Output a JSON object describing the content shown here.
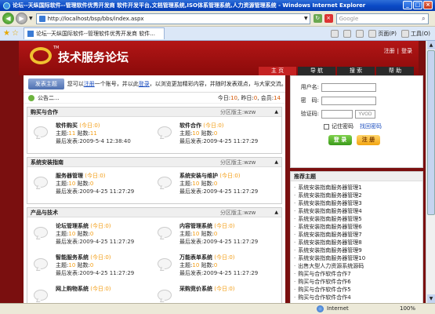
{
  "window": {
    "title": "论坛--天纵国际软件--管理软件优秀开发商 软件开发平台,文档管理系统,ISO体系管理系统,人力资源管理系统 - Windows Internet Explorer",
    "min": "_",
    "max": "□",
    "close": "×"
  },
  "address": {
    "url": "http://localhost/bsp/bbs/index.aspx"
  },
  "search": {
    "placeholder": "Google"
  },
  "tab": {
    "label": "论坛--天纵国际软件--管理软件优秀开发商 软件..."
  },
  "tools": {
    "page": "页面(P)",
    "tools": "工具(O)"
  },
  "header": {
    "logo_tm": "TM",
    "logo_text": "技术服务论坛",
    "register": "注册",
    "login": "登录",
    "nav": [
      "主 页",
      "导 航",
      "搜 索",
      "帮 助"
    ]
  },
  "topbar": {
    "post_button": "发表主题",
    "intro_prefix": "您可以",
    "intro_register": "注册",
    "intro_middle": "一个账号，并以此",
    "intro_login": "登录",
    "intro_suffix": "，以浏览更加精彩内容，并随时发表观点，与大家交流。"
  },
  "announcement": {
    "text": "公告二...",
    "today_label": "今日:",
    "today": "10",
    "yesterday_label": "昨日:",
    "yesterday": "0",
    "members_label": "会员:",
    "members": "14"
  },
  "sections": [
    {
      "title": "购买与合作",
      "moderators_label": "分区版主:",
      "moderator": "wzw",
      "forums": [
        {
          "name": "软件购买",
          "today": "(今日:0)",
          "topics_label": "主题:",
          "topics": "11",
          "posts_label": "贴数:",
          "posts": "11",
          "last": "最后发表:2009-5-4 12:38:40"
        },
        {
          "name": "软件合作",
          "today": "(今日:0)",
          "topics_label": "主题:",
          "topics": "10",
          "posts_label": "贴数:",
          "posts": "0",
          "last": "最后发表:2009-4-25 11:27:29"
        }
      ]
    },
    {
      "title": "系统安装指南",
      "moderators_label": "分区版主:",
      "moderator": "wzw",
      "forums": [
        {
          "name": "服务器管理",
          "today": "(今日:0)",
          "topics_label": "主题:",
          "topics": "10",
          "posts_label": "贴数:",
          "posts": "0",
          "last": "最后发表:2009-4-25 11:27:29"
        },
        {
          "name": "系统安装与维护",
          "today": "(今日:0)",
          "topics_label": "主题:",
          "topics": "10",
          "posts_label": "贴数:",
          "posts": "0",
          "last": "最后发表:2009-4-25 11:27:29"
        }
      ]
    },
    {
      "title": "产品与技术",
      "moderators_label": "分区版主:",
      "moderator": "wzw",
      "forums": [
        {
          "name": "论坛管理系统",
          "today": "(今日:0)",
          "topics_label": "主题:",
          "topics": "10",
          "posts_label": "贴数:",
          "posts": "0",
          "last": "最后发表:2009-4-25 11:27:29"
        },
        {
          "name": "内容管理系统",
          "today": "(今日:0)",
          "topics_label": "主题:",
          "topics": "10",
          "posts_label": "贴数:",
          "posts": "0",
          "last": "最后发表:2009-4-25 11:27:29"
        },
        {
          "name": "智能服务系统",
          "today": "(今日:0)",
          "topics_label": "主题:",
          "topics": "10",
          "posts_label": "贴数:",
          "posts": "0",
          "last": "最后发表:2009-4-25 11:27:29"
        },
        {
          "name": "万能表单系统",
          "today": "(今日:0)",
          "topics_label": "主题:",
          "topics": "10",
          "posts_label": "贴数:",
          "posts": "0",
          "last": "最后发表:2009-4-25 11:27:29"
        },
        {
          "name": "网上购物系统",
          "today": "(今日:0)",
          "topics_label": "",
          "topics": "",
          "posts_label": "",
          "posts": "",
          "last": ""
        },
        {
          "name": "采购竞价系统",
          "today": "(今日:0)",
          "topics_label": "",
          "topics": "",
          "posts_label": "",
          "posts": "",
          "last": ""
        }
      ]
    }
  ],
  "login": {
    "username_label": "用户名:",
    "password_label": "密　码:",
    "code_label": "验证码:",
    "code_image": "YVOD",
    "remember": "记住密码",
    "lost": "找回密码",
    "login_button": "登 录",
    "register_button": "注 册"
  },
  "recommended": {
    "title": "推荐主题",
    "items": [
      "系统安装指南服务器管理1",
      "系统安装指南服务器管理2",
      "系统安装指南服务器管理3",
      "系统安装指南服务器管理4",
      "系统安装指南服务器管理5",
      "系统安装指南服务器管理6",
      "系统安装指南服务器管理7",
      "系统安装指南服务器管理8",
      "系统安装指南服务器管理9",
      "系统安装指南服务器管理10",
      "出售大型人力资源系统源码",
      "购买与合作软件合作7",
      "购买与合作软件合作6",
      "购买与合作软件合作5",
      "购买与合作软件合作4"
    ]
  },
  "status": {
    "zone": "Internet",
    "zoom": "100%"
  }
}
